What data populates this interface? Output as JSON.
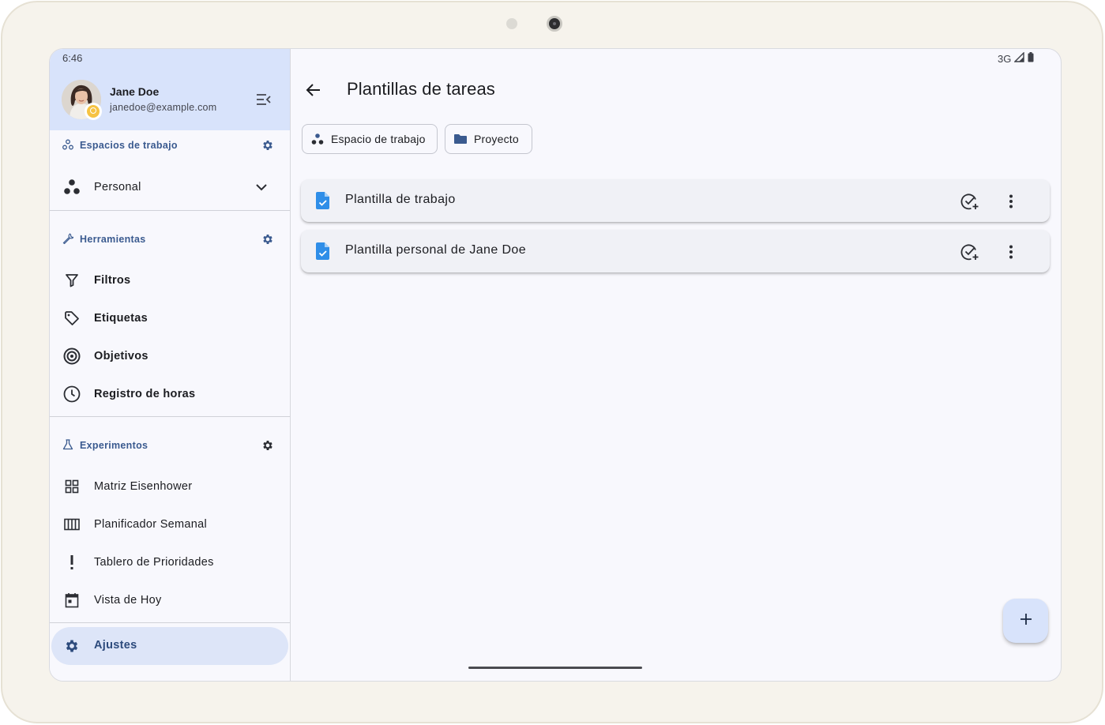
{
  "status_bar": {
    "time": "6:46",
    "network": "3G"
  },
  "user": {
    "name": "Jane Doe",
    "email": "janedoe@example.com"
  },
  "sidebar": {
    "workspaces": {
      "title": "Espacios de trabajo",
      "selected": "Personal"
    },
    "tools": {
      "title": "Herramientas",
      "items": [
        {
          "label": "Filtros",
          "icon": "filter-icon"
        },
        {
          "label": "Etiquetas",
          "icon": "tag-icon"
        },
        {
          "label": "Objetivos",
          "icon": "target-icon"
        },
        {
          "label": "Registro de horas",
          "icon": "clock-icon"
        }
      ]
    },
    "experiments": {
      "title": "Experimentos",
      "items": [
        {
          "label": "Matriz Eisenhower",
          "icon": "grid-icon"
        },
        {
          "label": "Planificador Semanal",
          "icon": "calendar-view-week-icon"
        },
        {
          "label": "Tablero de Prioridades",
          "icon": "priority-icon"
        },
        {
          "label": "Vista de Hoy",
          "icon": "calendar-today-icon"
        }
      ]
    },
    "settings_label": "Ajustes"
  },
  "main": {
    "title": "Plantillas de tareas",
    "chips": [
      {
        "label": "Espacio de trabajo",
        "icon": "workspace-icon"
      },
      {
        "label": "Proyecto",
        "icon": "folder-icon"
      }
    ],
    "templates": [
      {
        "title": "Plantilla de trabajo"
      },
      {
        "title": "Plantilla personal de Jane Doe"
      }
    ]
  },
  "colors": {
    "accent": "#3a5a8f",
    "header_bg": "#d8e3fb",
    "doc_icon": "#2f8ee8"
  }
}
